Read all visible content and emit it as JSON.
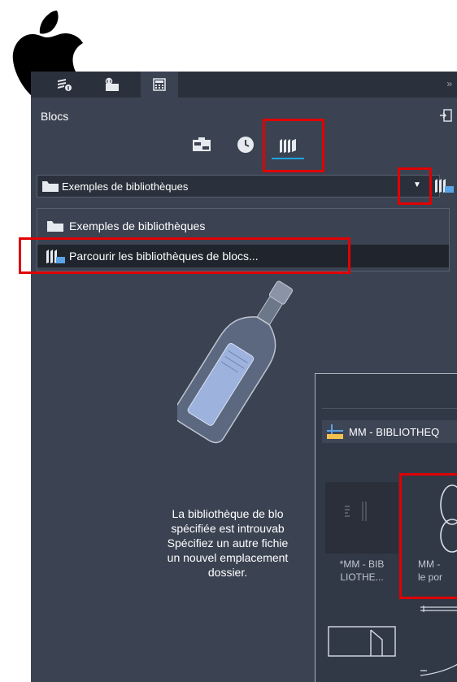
{
  "panel": {
    "title": "Blocs",
    "tabs_more": "»"
  },
  "library_selector": {
    "selected": "Exemples de bibliothèques"
  },
  "dropdown": {
    "items": [
      {
        "label": "Exemples de bibliothèques",
        "highlighted": false
      },
      {
        "label": "Parcourir les bibliothèques de blocs...",
        "highlighted": true
      }
    ]
  },
  "empty_state": {
    "lines": [
      "La bibliothèque de blo",
      "spécifiée est introuvab",
      "Spécifiez un autre fichie",
      "un nouvel emplacement",
      "dossier."
    ]
  },
  "overlay": {
    "header": "MM - BIBLIOTHEQ",
    "thumbnails": [
      {
        "label_line1": "*MM - BIB",
        "label_line2": "LIOTHE..."
      },
      {
        "label_line1": "MM -",
        "label_line2": "le por"
      }
    ]
  },
  "colors": {
    "panel_bg": "#3b4352",
    "tabbar_bg": "#2b313c",
    "highlight": "#e00000",
    "accent": "#1fa5e0"
  }
}
